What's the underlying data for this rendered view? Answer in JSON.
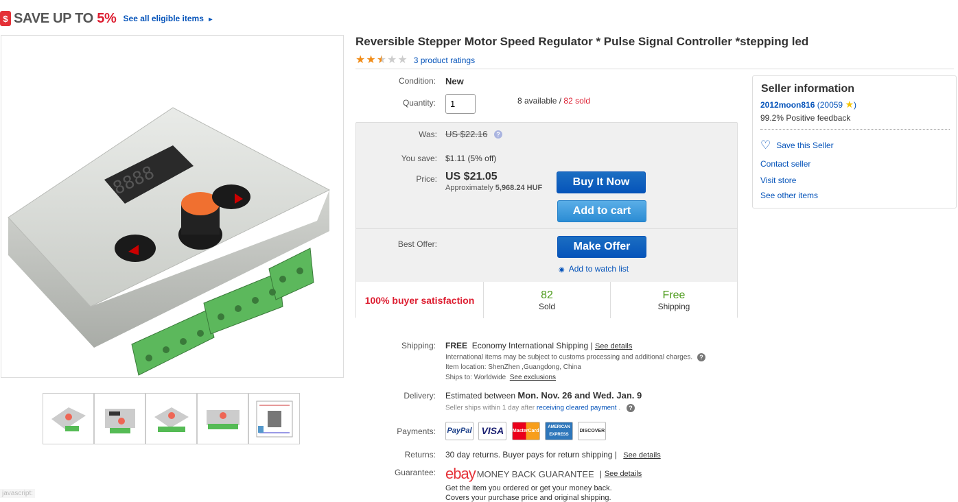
{
  "promo": {
    "icon": "dollar-tag-icon",
    "prefix": "SAVE UP TO",
    "percent": "5%",
    "link": "See all eligible items",
    "arrow": "▸"
  },
  "product": {
    "title": "Reversible Stepper Motor Speed Regulator * Pulse Signal Controller *stepping led",
    "rating_stars": 2.5,
    "rating_link": "3 product ratings"
  },
  "details": {
    "condition_label": "Condition:",
    "condition_value": "New",
    "quantity_label": "Quantity:",
    "quantity_value": "1",
    "available": "8 available",
    "sep": "/",
    "sold": "82 sold"
  },
  "pricing": {
    "was_label": "Was:",
    "was_value": "US $22.16",
    "save_label": "You save:",
    "save_value": "$1.11 (5% off)",
    "price_label": "Price:",
    "price_value": "US $21.05",
    "approx_prefix": "Approximately",
    "approx_value": "5,968.24 HUF",
    "buy_now": "Buy It Now",
    "add_to_cart": "Add to cart",
    "best_offer_label": "Best Offer:",
    "make_offer": "Make Offer",
    "watch": "Add to watch list"
  },
  "stats": {
    "satisfaction": "100% buyer satisfaction",
    "sold_num": "82",
    "sold_label": "Sold",
    "ship_num": "Free",
    "ship_label": "Shipping"
  },
  "seller": {
    "heading": "Seller information",
    "name": "2012moon816",
    "score_open": "(",
    "score": "20059",
    "score_close": ")",
    "feedback": "99.2% Positive feedback",
    "save_seller": "Save this Seller",
    "contact": "Contact seller",
    "visit": "Visit store",
    "other": "See other items"
  },
  "shipping": {
    "label": "Shipping:",
    "free": "FREE",
    "method": "Economy International Shipping |",
    "see_details": "See details",
    "note": "International items may be subject to customs processing and additional charges.",
    "location": "Item location:   ShenZhen ,Guangdong, China",
    "ships_to_label": "Ships to:  Worldwide",
    "see_exclusions": "See exclusions"
  },
  "delivery": {
    "label": "Delivery:",
    "estimated": "Estimated between",
    "dates": "Mon. Nov. 26 and Wed. Jan. 9",
    "note_prefix": "Seller ships within 1 day after",
    "note_link": "receiving cleared payment",
    "note_end": "."
  },
  "payments": {
    "label": "Payments:",
    "logos": [
      "PayPal",
      "VISA",
      "MasterCard",
      "AMERICAN EXPRESS",
      "DISCOVER"
    ]
  },
  "returns": {
    "label": "Returns:",
    "text": "30 day returns. Buyer pays for return shipping |",
    "see_details": "See details"
  },
  "guarantee": {
    "label": "Guarantee:",
    "ebay": "ebay",
    "title": "MONEY BACK GUARANTEE",
    "sep": "|",
    "see_details": "See details",
    "line1": "Get the item you ordered or get your money back.",
    "line2": "Covers your purchase price and original shipping."
  },
  "status": {
    "text": "javascript:"
  },
  "colors": {
    "link": "#0654ba",
    "sale_red": "#dd1e31",
    "green": "#4b9a19",
    "star": "#f18c18",
    "button": "#0654ba"
  }
}
